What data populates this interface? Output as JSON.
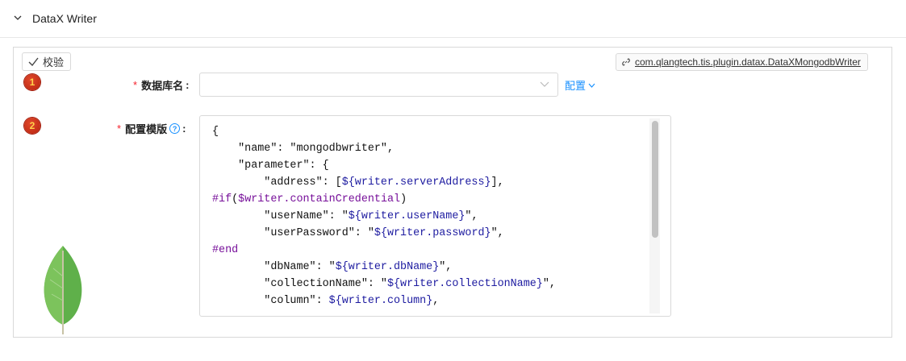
{
  "section": {
    "title": "DataX Writer"
  },
  "toolbar": {
    "validate_label": "校验",
    "plugin_class": "com.qlangtech.tis.plugin.datax.DataXMongodbWriter"
  },
  "fields": [
    {
      "index": "1",
      "label": "数据库名",
      "required": "*",
      "colon": ":",
      "value": "",
      "config_link": "配置"
    },
    {
      "index": "2",
      "label": "配置模版",
      "required": "*",
      "colon": ":"
    }
  ],
  "code_lines": [
    "{",
    "    \"name\": \"mongodbwriter\",",
    "    \"parameter\": {",
    "        \"address\": [${writer.serverAddress}],",
    "#if($writer.containCredential)",
    "        \"userName\": \"${writer.userName}\",",
    "        \"userPassword\": \"${writer.password}\",",
    "#end",
    "        \"dbName\": \"${writer.dbName}\",",
    "        \"collectionName\": \"${writer.collectionName}\",",
    "        \"column\": ${writer.column},"
  ],
  "colors": {
    "required": "#f5222d",
    "link": "#1890ff",
    "badge": "#c8290f",
    "template_var": "#1d1ba0",
    "directive": "#77109a",
    "leaf": "#4caf50"
  },
  "icons": [
    "chevron-down-icon",
    "check-icon",
    "link-icon",
    "help-icon",
    "mongodb-leaf-icon"
  ]
}
